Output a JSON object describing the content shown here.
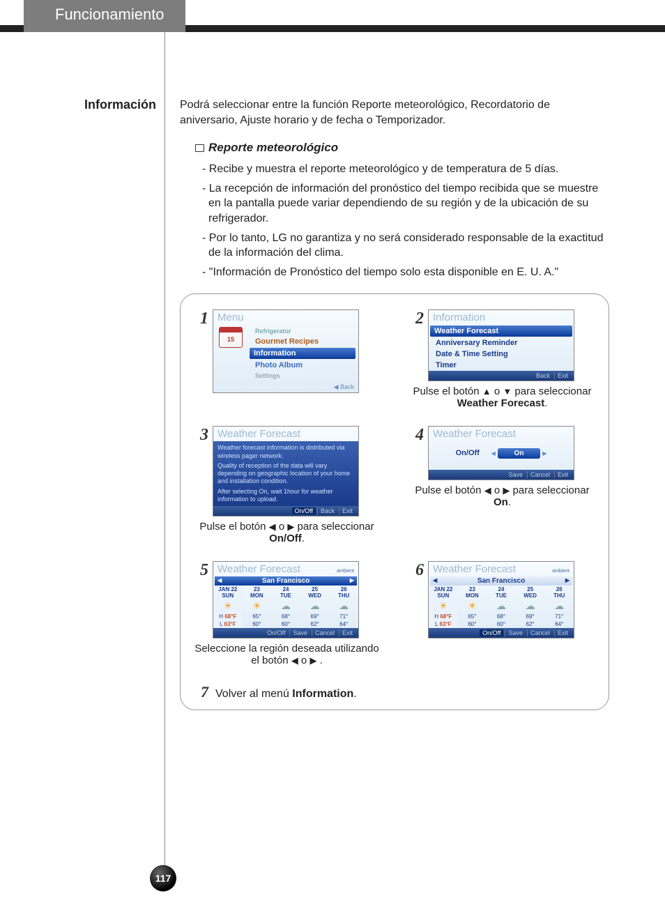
{
  "header": {
    "tab": "Funcionamiento"
  },
  "section": {
    "title": "Información",
    "intro": "Podrá seleccionar entre la función Reporte meteorológico, Recordatorio de aniversario, Ajuste horario y de fecha o Temporizador.",
    "sub_heading": "Reporte meteorológico",
    "bullets": [
      "Recibe y muestra el reporte meteorológico y de temperatura de 5 días.",
      "La recepción de información del pronóstico del tiempo recibida que se muestre en la pantalla puede variar dependiendo de su región y de la ubicación de su refrigerador.",
      "Por lo tanto, LG no garantiza y no será considerado responsable de la exactitud de la información del clima.",
      "\"Información de Pronóstico del tiempo solo esta disponible en E. U. A.\""
    ]
  },
  "steps": {
    "n1": "1",
    "n2": "2",
    "n3": "3",
    "n4": "4",
    "n5": "5",
    "n6": "6",
    "n7": "7",
    "cap2a": "Pulse el botón ",
    "cap2b": " o ",
    "cap2c": " para seleccionar ",
    "cap2_bold": "Weather Forecast",
    "cap2d": ".",
    "cap3a": "Pulse el botón ",
    "cap3b": " o ",
    "cap3c": " para seleccionar ",
    "cap3_bold": "On/Off",
    "cap3d": ".",
    "cap4a": "Pulse el botón ",
    "cap4b": " o ",
    "cap4c": "  para seleccionar ",
    "cap4_bold": "On",
    "cap4d": ".",
    "cap5a": "Seleccione la región deseada utilizando el botón ",
    "cap5b": " o ",
    "cap5c": " .",
    "cap7a": "Volver al menú ",
    "cap7_bold": "Information",
    "cap7b": "."
  },
  "screens": {
    "s1": {
      "title": "Menu",
      "cal": "15",
      "items": [
        "Refrigerator",
        "Gourmet Recipes",
        "Information",
        "Photo Album",
        "Settings"
      ],
      "back": "◀ Back"
    },
    "s2": {
      "title": "Information",
      "items": [
        "Weather Forecast",
        "Anniversary Reminder",
        "Date & Time Setting",
        "Timer"
      ],
      "footer": [
        "Back",
        "Exit"
      ]
    },
    "s3": {
      "title": "Weather Forecast",
      "body1": "Weather forecast information is distributed via wireless pager network.",
      "body2": "Quality of reception of the data will vary depending on geographic location of your home and installation condition.",
      "body3": "After selecting On, wait 1hour for weather information to upload.",
      "footer": [
        "On/Off",
        "Back",
        "Exit"
      ]
    },
    "s4": {
      "title": "Weather Forecast",
      "label": "On/Off",
      "value": "On",
      "footer": [
        "Save",
        "Cancel",
        "Exit"
      ]
    },
    "s5": {
      "title": "Weather Forecast",
      "city": "San Francisco",
      "ambient": "ambient",
      "days": [
        {
          "d1": "JAN 22",
          "d2": "SUN",
          "hi": "68°F",
          "lo": "63°F",
          "hl": "H",
          "ll": "L"
        },
        {
          "d1": "23",
          "d2": "MON",
          "hi": "65°",
          "lo": "60°"
        },
        {
          "d1": "24",
          "d2": "TUE",
          "hi": "68°",
          "lo": "60°"
        },
        {
          "d1": "25",
          "d2": "WED",
          "hi": "69°",
          "lo": "62°"
        },
        {
          "d1": "26",
          "d2": "THU",
          "hi": "71°",
          "lo": "64°"
        }
      ],
      "footer": [
        "On/Off",
        "Save",
        "Cancel",
        "Exit"
      ]
    }
  },
  "page_number": "117"
}
